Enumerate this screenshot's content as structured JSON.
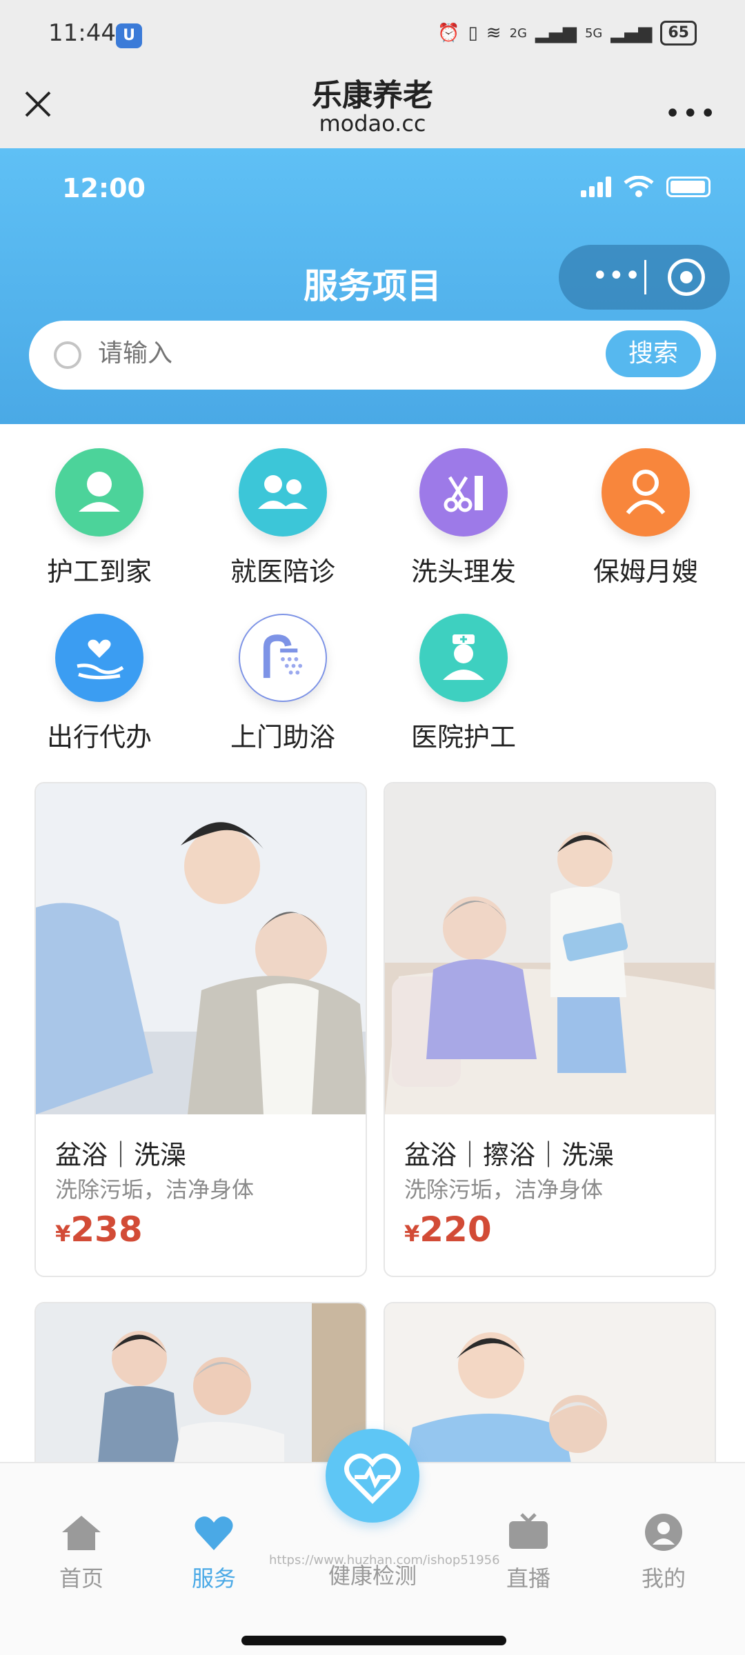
{
  "system": {
    "time": "11:44",
    "battery": "65",
    "net1": "2G",
    "net2": "5G"
  },
  "miniProgram": {
    "title": "乐康养老",
    "subtitle": "modao.cc"
  },
  "appStatus": {
    "time": "12:00"
  },
  "header": {
    "title": "服务项目"
  },
  "search": {
    "placeholder": "请输入",
    "button": "搜索"
  },
  "services": [
    {
      "label": "护工到家",
      "icon": "caregiver-icon",
      "color": "#4cd39a"
    },
    {
      "label": "就医陪诊",
      "icon": "companions-icon",
      "color": "#3cc6d8"
    },
    {
      "label": "洗头理发",
      "icon": "scissors-comb-icon",
      "color": "#9d7ae8"
    },
    {
      "label": "保姆月嫂",
      "icon": "nanny-icon",
      "color": "#f8863c"
    },
    {
      "label": "出行代办",
      "icon": "heart-hand-icon",
      "color": "#3b9df2"
    },
    {
      "label": "上门助浴",
      "icon": "shower-icon",
      "color": "#ffffff"
    },
    {
      "label": "医院护工",
      "icon": "nurse-icon",
      "color": "#3ed0c0"
    }
  ],
  "products": [
    {
      "name": "盆浴｜洗澡",
      "desc": "洗除污垢，洁净身体",
      "currency": "¥",
      "price": "238"
    },
    {
      "name": "盆浴｜擦浴｜洗澡",
      "desc": "洗除污垢，洁净身体",
      "currency": "¥",
      "price": "220"
    }
  ],
  "tabs": [
    {
      "label": "首页",
      "icon": "home-icon"
    },
    {
      "label": "服务",
      "icon": "heart-icon"
    },
    {
      "label": "健康检测",
      "icon": "heart-pulse-icon"
    },
    {
      "label": "直播",
      "icon": "tv-icon"
    },
    {
      "label": "我的",
      "icon": "user-icon"
    }
  ],
  "watermark": "https://www.huzhan.com/ishop51956",
  "colors": {
    "primary": "#4aa9e6",
    "price": "#d24b36"
  }
}
